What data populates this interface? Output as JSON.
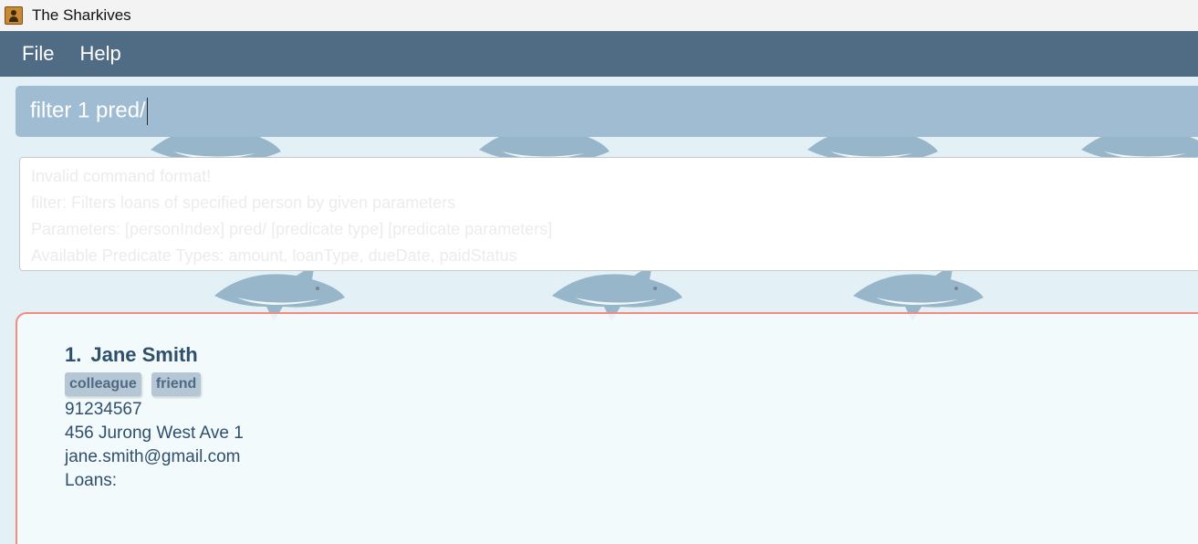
{
  "window": {
    "title": "The Sharkives",
    "icon": "contact-book-icon"
  },
  "menu": {
    "items": [
      "File",
      "Help"
    ]
  },
  "command": {
    "value": "filter 1 pred/"
  },
  "result": {
    "lines": [
      "Invalid command format!",
      "filter: Filters loans of specified person by given parameters",
      "Parameters: [personIndex] pred/ [predicate type] [predicate parameters]",
      "Available Predicate Types: amount, loanType, dueDate, paidStatus"
    ]
  },
  "person": {
    "index": "1.",
    "name": "Jane Smith",
    "tags": [
      "colleague",
      "friend"
    ],
    "phone": "91234567",
    "address": "456 Jurong West Ave 1",
    "email": "jane.smith@gmail.com",
    "loans_label": "Loans:"
  },
  "colors": {
    "menubar": "#506b84",
    "command_box": "#9fbcd3",
    "card_border": "#f28b82",
    "text_primary": "#2f4f6a",
    "tag_bg": "#b5c6d4",
    "background": "#e3f1f7"
  }
}
